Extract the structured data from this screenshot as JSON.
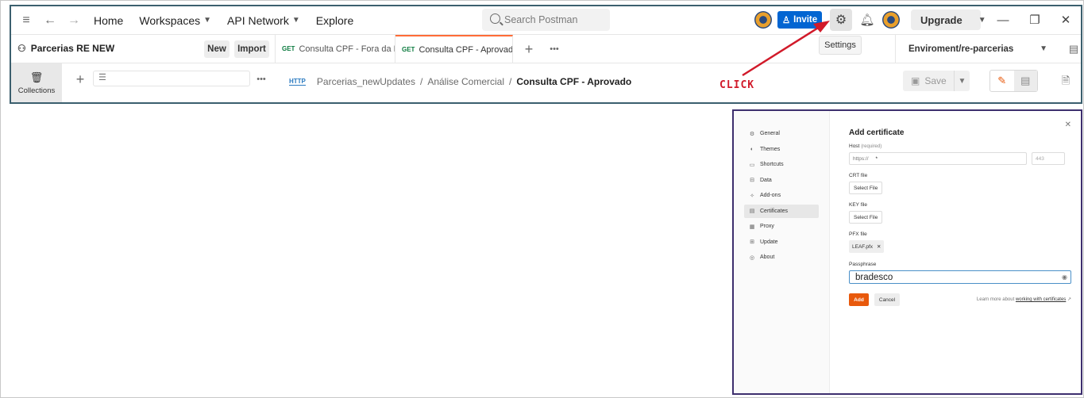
{
  "topbar": {
    "home": "Home",
    "workspaces": "Workspaces",
    "api_network": "API Network",
    "explore": "Explore",
    "search_placeholder": "Search Postman",
    "invite": "Invite",
    "upgrade": "Upgrade"
  },
  "tooltip": {
    "settings": "Settings"
  },
  "workspace": {
    "name": "Parcerias RE NEW",
    "new_label": "New",
    "import_label": "Import"
  },
  "tabs": [
    {
      "method": "GET",
      "label": "Consulta CPF - Fora da B"
    },
    {
      "method": "GET",
      "label": "Consulta CPF - Aprovado"
    }
  ],
  "environment": {
    "selected": "Enviroment/re-parcerias"
  },
  "sidebar": {
    "collections_label": "Collections"
  },
  "breadcrumb": {
    "method_icon": "HTTP",
    "parts": [
      "Parcerias_newUpdates",
      "Análise Comercial"
    ],
    "current": "Consulta CPF - Aprovado"
  },
  "request": {
    "save_label": "Save"
  },
  "annotation": {
    "click_label": "CLICK",
    "color": "#d11a2a"
  },
  "settings": {
    "nav": [
      {
        "icon": "gear-icon",
        "glyph": "⚙",
        "label": "General"
      },
      {
        "icon": "themes-icon",
        "glyph": "◐",
        "label": "Themes"
      },
      {
        "icon": "keyboard-icon",
        "glyph": "▭",
        "label": "Shortcuts"
      },
      {
        "icon": "data-icon",
        "glyph": "⊟",
        "label": "Data"
      },
      {
        "icon": "addons-icon",
        "glyph": "✧",
        "label": "Add-ons"
      },
      {
        "icon": "certificates-icon",
        "glyph": "▤",
        "label": "Certificates"
      },
      {
        "icon": "proxy-icon",
        "glyph": "▦",
        "label": "Proxy"
      },
      {
        "icon": "update-icon",
        "glyph": "⊞",
        "label": "Update"
      },
      {
        "icon": "about-icon",
        "glyph": "◎",
        "label": "About"
      }
    ],
    "active_nav": "Certificates",
    "title": "Add certificate",
    "host_label": "Host",
    "host_required": "(required)",
    "host_prefix": "https://",
    "host_value": "*",
    "port_placeholder": "443",
    "crt_label": "CRT file",
    "crt_button": "Select File",
    "key_label": "KEY file",
    "key_button": "Select File",
    "pfx_label": "PFX file",
    "pfx_file": "LEAF.pfx",
    "passphrase_label": "Passphrase",
    "passphrase_value": "bradesco",
    "add_label": "Add",
    "cancel_label": "Cancel",
    "learn_prefix": "Learn more about",
    "learn_link": "working with certificates",
    "accent": "#e8590c"
  }
}
